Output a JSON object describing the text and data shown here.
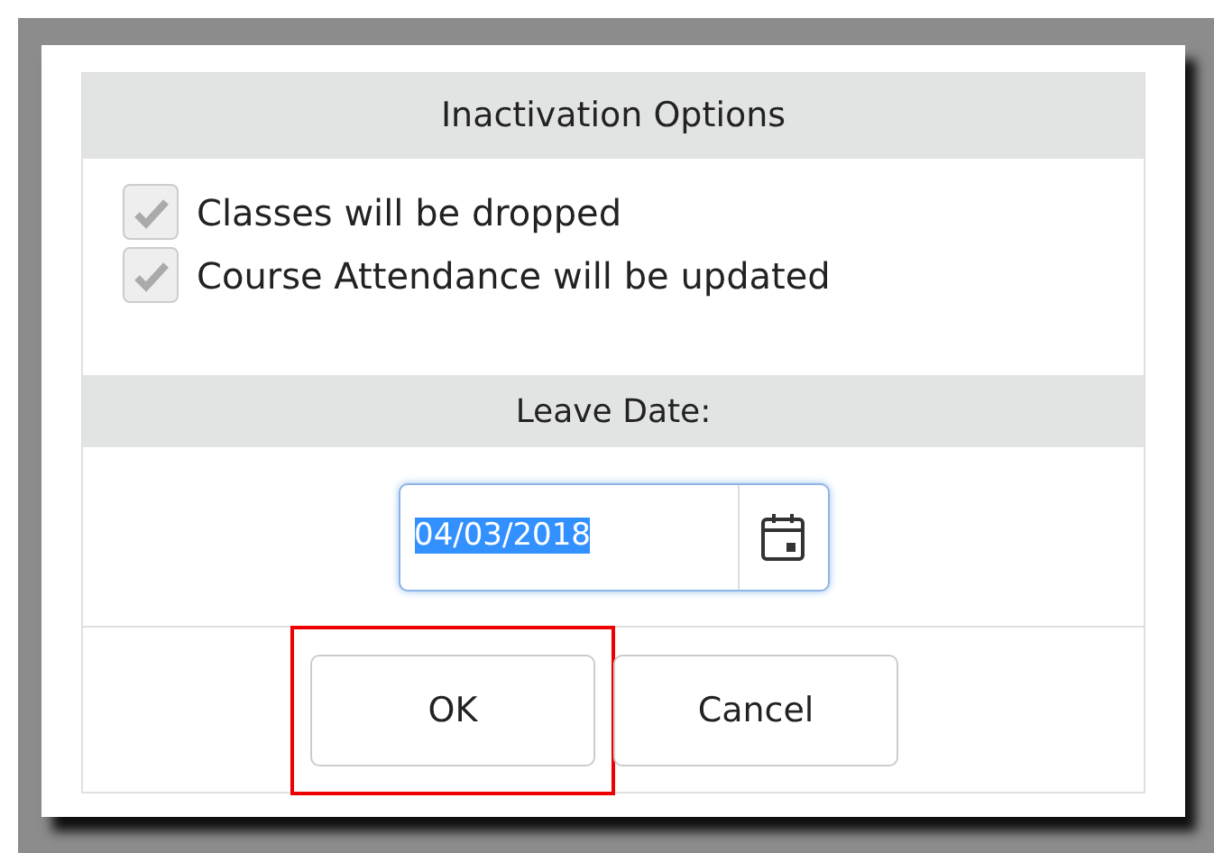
{
  "dialog": {
    "title": "Inactivation Options",
    "options": [
      {
        "label": "Classes will be dropped",
        "checked": true,
        "disabled": true
      },
      {
        "label": "Course Attendance will be updated",
        "checked": true,
        "disabled": true
      }
    ],
    "date_section": {
      "title": "Leave Date:",
      "value": "04/03/2018",
      "value_selected": true
    },
    "buttons": [
      {
        "label": "OK",
        "highlighted": true
      },
      {
        "label": "Cancel",
        "highlighted": false
      }
    ]
  }
}
